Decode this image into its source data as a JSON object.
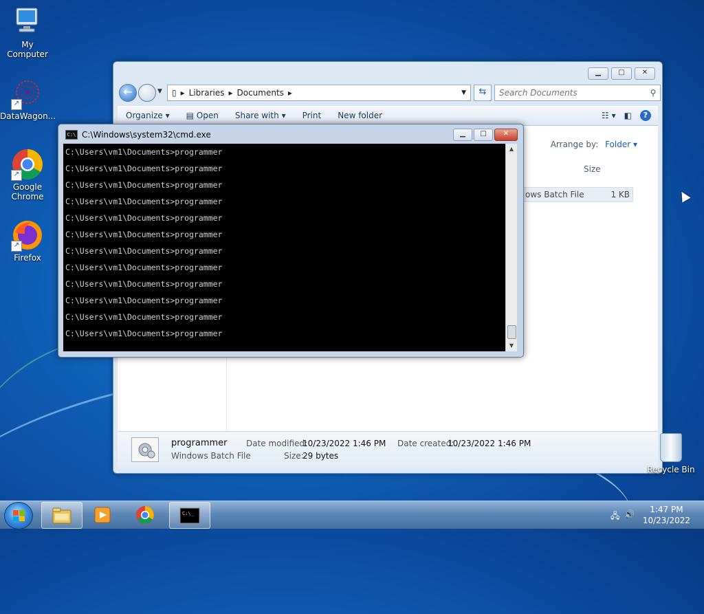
{
  "desktop": {
    "icons": [
      {
        "label": "My Computer"
      },
      {
        "label": "DataWagon..."
      },
      {
        "label": "Google Chrome"
      },
      {
        "label": "Firefox"
      }
    ],
    "recycle_bin": "Recycle Bin"
  },
  "explorer": {
    "breadcrumbs": [
      "Libraries",
      "Documents"
    ],
    "search_placeholder": "Search Documents",
    "commands": {
      "organize": "Organize",
      "open": "Open",
      "share_with": "Share with",
      "print": "Print",
      "new_folder": "New folder"
    },
    "arrange_by_label": "Arrange by:",
    "arrange_by_value": "Folder",
    "column_size": "Size",
    "file_row": {
      "type": "ows Batch File",
      "size": "1 KB"
    },
    "details": {
      "name": "programmer",
      "type": "Windows Batch File",
      "date_modified_label": "Date modified:",
      "date_modified": "10/23/2022 1:46 PM",
      "date_created_label": "Date created:",
      "date_created": "10/23/2022 1:46 PM",
      "size_label": "Size:",
      "size": "29 bytes"
    }
  },
  "cmd": {
    "title": "C:\\Windows\\system32\\cmd.exe",
    "lines": [
      "C:\\Users\\vm1\\Documents>programmer",
      "C:\\Users\\vm1\\Documents>programmer",
      "C:\\Users\\vm1\\Documents>programmer",
      "C:\\Users\\vm1\\Documents>programmer",
      "C:\\Users\\vm1\\Documents>programmer",
      "C:\\Users\\vm1\\Documents>programmer",
      "C:\\Users\\vm1\\Documents>programmer",
      "C:\\Users\\vm1\\Documents>programmer",
      "C:\\Users\\vm1\\Documents>programmer",
      "C:\\Users\\vm1\\Documents>programmer",
      "C:\\Users\\vm1\\Documents>programmer",
      "C:\\Users\\vm1\\Documents>programmer"
    ]
  },
  "taskbar": {
    "time": "1:47 PM",
    "date": "10/23/2022"
  }
}
